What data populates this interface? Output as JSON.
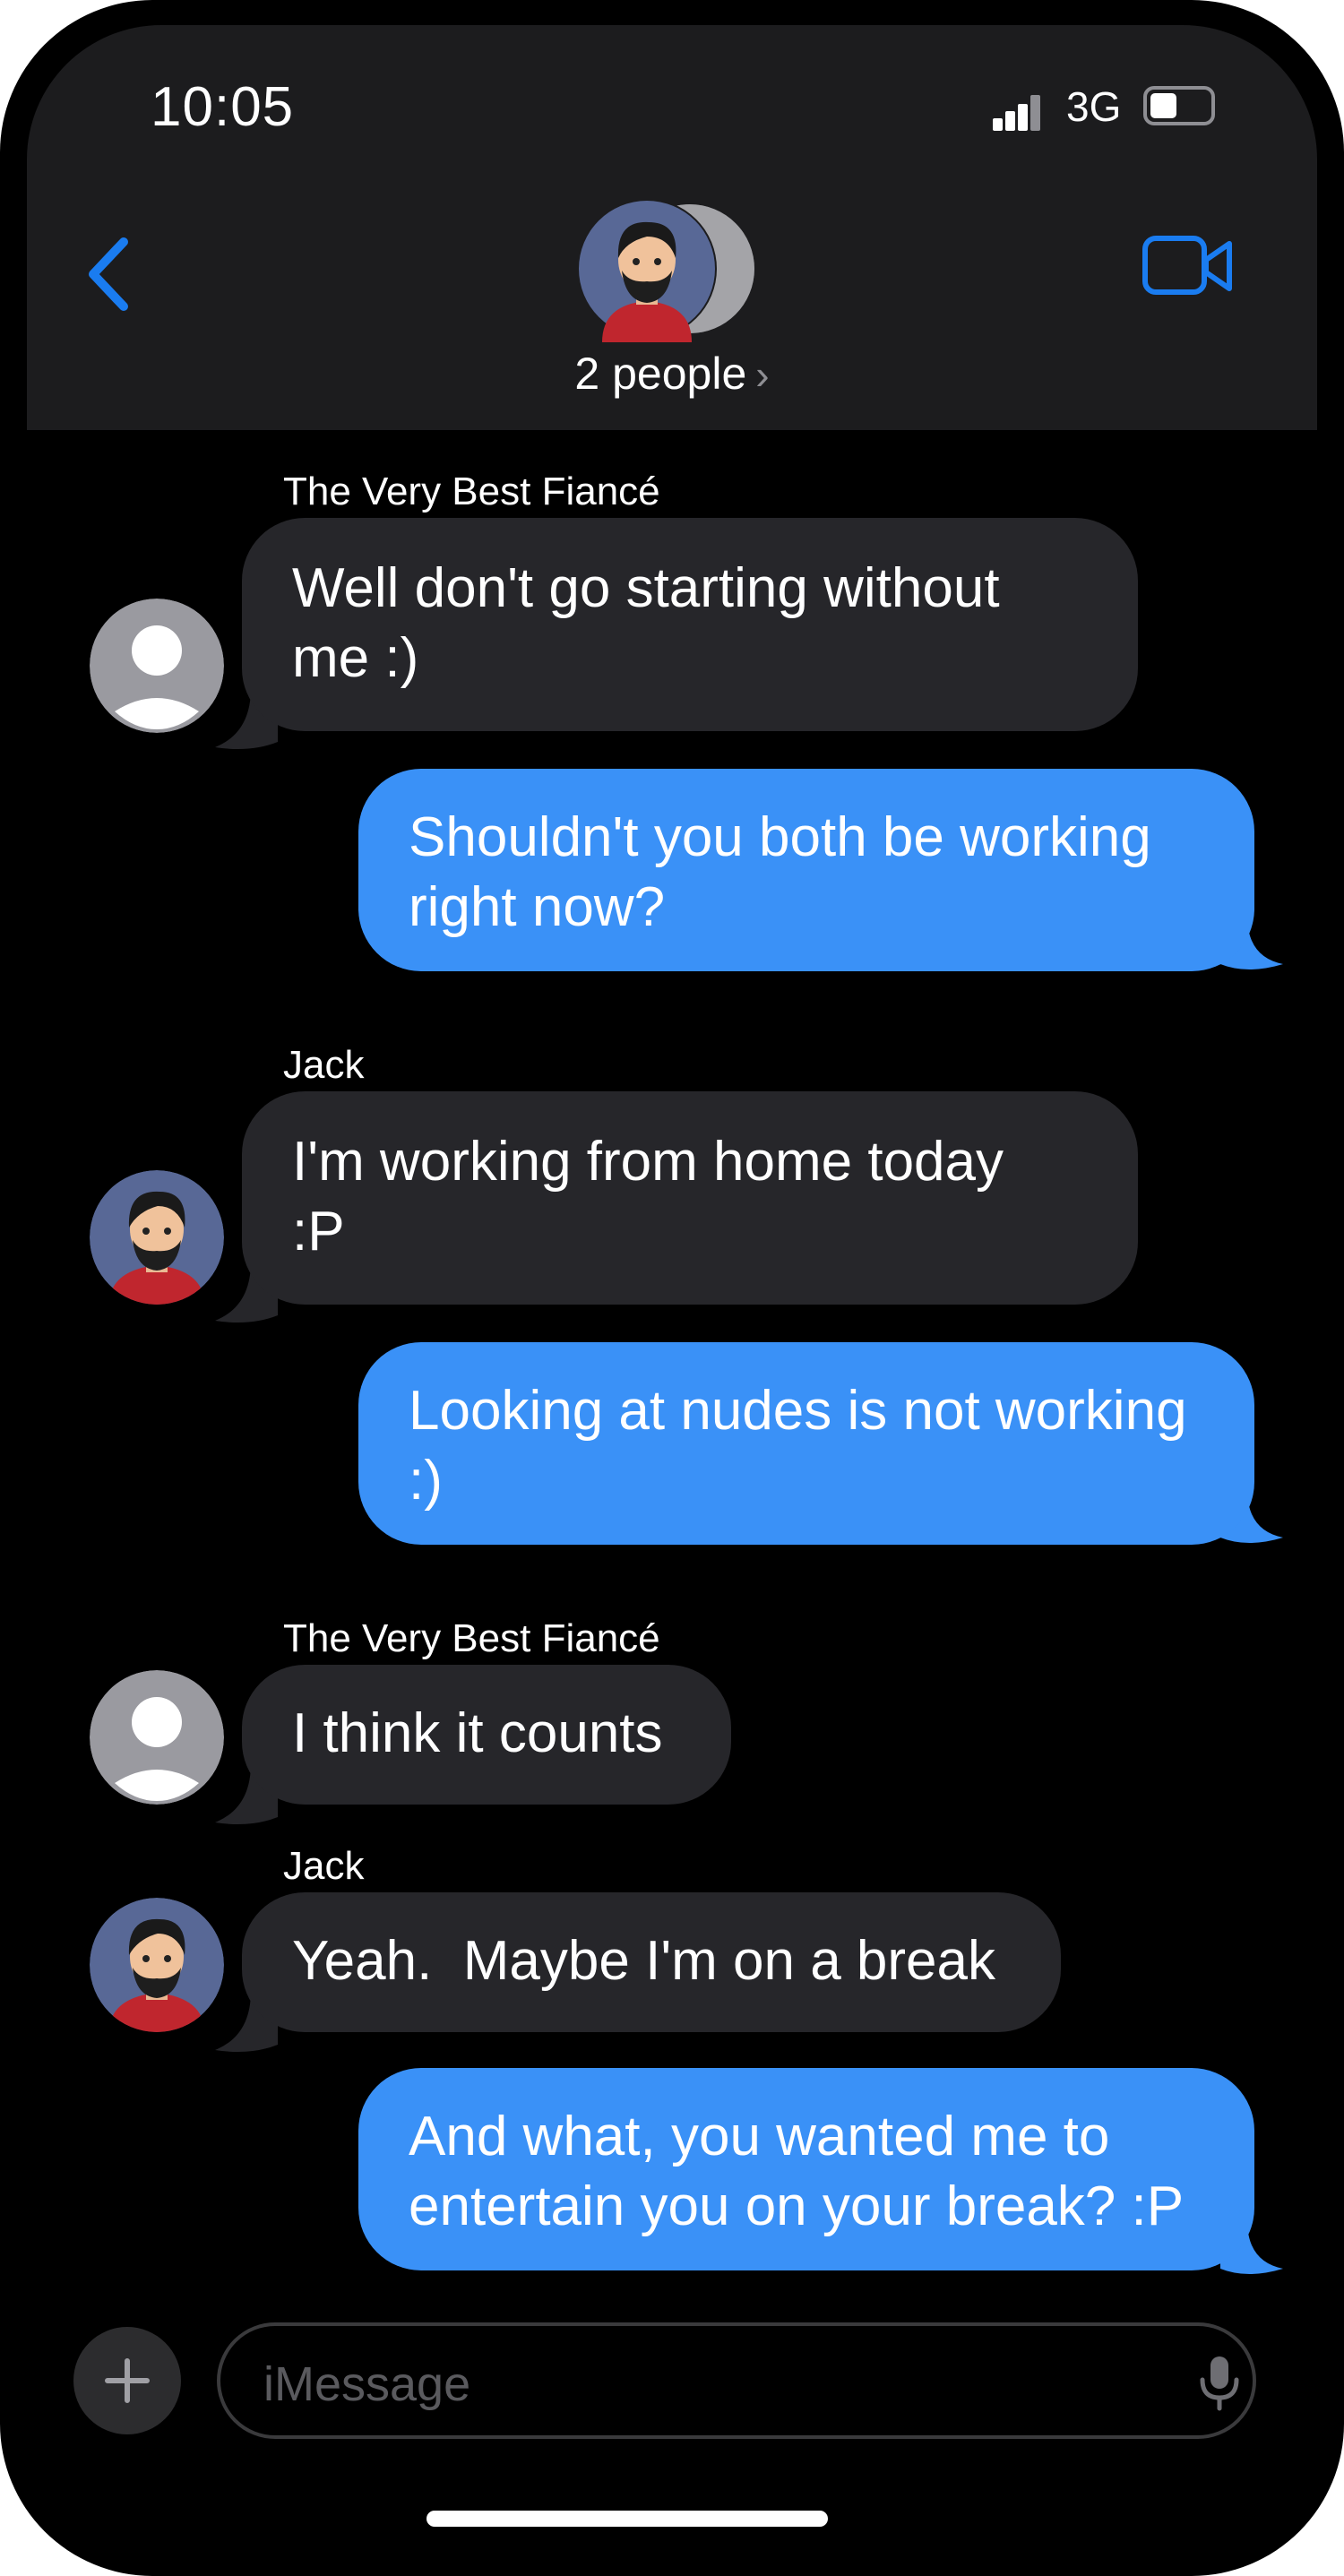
{
  "status_bar": {
    "time": "10:05",
    "network": "3G",
    "battery_level": 0.45
  },
  "header": {
    "group_label": "2 people",
    "chevron": "›",
    "back_icon": "chevron-left-icon",
    "video_icon": "video-camera-icon"
  },
  "messages": [
    {
      "direction": "incoming",
      "sender": "The Very Best Fiancé",
      "avatar": "person-silhouette",
      "lines": [
        "Well don't go starting without",
        "me :)"
      ]
    },
    {
      "direction": "outgoing",
      "lines": [
        "Shouldn't you both be working",
        "right now?"
      ]
    },
    {
      "direction": "incoming",
      "sender": "Jack",
      "avatar": "memoji-bearded-man",
      "lines": [
        "I'm working from home today",
        ":P"
      ]
    },
    {
      "direction": "outgoing",
      "lines": [
        "Looking at nudes is not working",
        ":)"
      ]
    },
    {
      "direction": "incoming",
      "sender": "The Very Best Fiancé",
      "avatar": "person-silhouette",
      "lines": [
        "I think it counts"
      ]
    },
    {
      "direction": "incoming",
      "sender": "Jack",
      "avatar": "memoji-bearded-man",
      "lines": [
        "Yeah.  Maybe I'm on a break"
      ]
    },
    {
      "direction": "outgoing",
      "lines": [
        "And what, you wanted me to",
        "entertain you on your break? :P"
      ]
    }
  ],
  "composer": {
    "placeholder": "iMessage"
  },
  "colors": {
    "outgoing_bubble": "#3a91f7",
    "incoming_bubble": "#26262a",
    "accent": "#1a7cf0",
    "header_bg": "#1c1c1e"
  }
}
